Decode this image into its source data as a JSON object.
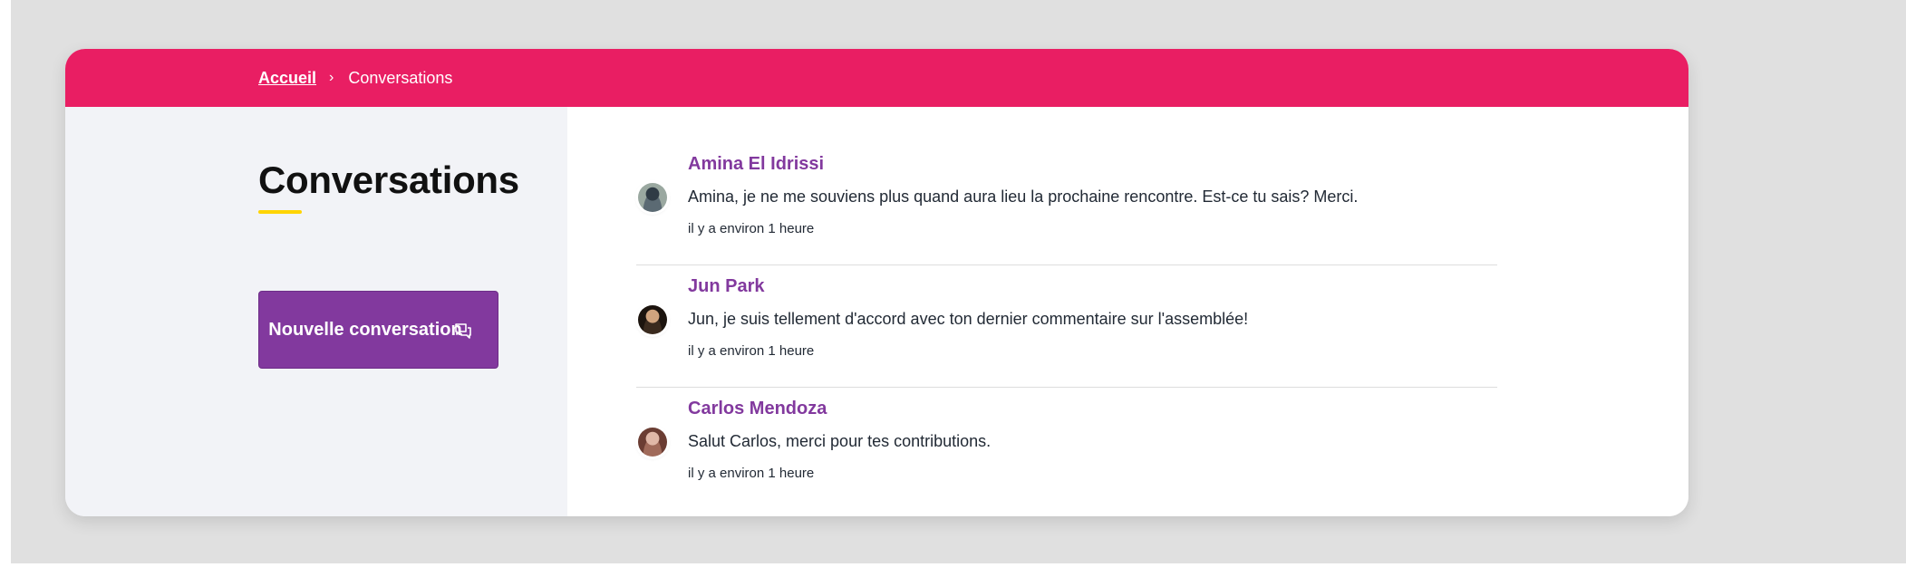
{
  "breadcrumb": {
    "home": "Accueil",
    "separator": "›",
    "current": "Conversations"
  },
  "sidebar": {
    "title": "Conversations",
    "new_button_label": "Nouvelle conversation",
    "new_button_icon": "chat-bubbles-icon"
  },
  "conversations": [
    {
      "name": "Amina El Idrissi",
      "message": "Amina, je ne me souviens plus quand aura lieu la prochaine rencontre. Est-ce tu sais? Merci.",
      "time": "il y a environ 1 heure",
      "avatar_colors": [
        "#5b6a73",
        "#2f3b45",
        "#9aa8a0"
      ]
    },
    {
      "name": "Jun Park",
      "message": "Jun, je suis tellement d'accord avec ton dernier commentaire sur l'assemblée!",
      "time": "il y a environ 1 heure",
      "avatar_colors": [
        "#3a2a1e",
        "#d1a47e",
        "#1c140e"
      ]
    },
    {
      "name": "Carlos Mendoza",
      "message": "Salut Carlos, merci pour tes contributions.",
      "time": "il y a environ 1 heure",
      "avatar_colors": [
        "#a06a5a",
        "#e0b8a8",
        "#6b3d33"
      ]
    }
  ],
  "colors": {
    "topbar": "#e91e63",
    "accent_purple": "#82399e",
    "title_underline": "#ffd400",
    "sidebar_bg": "#f2f3f7"
  }
}
